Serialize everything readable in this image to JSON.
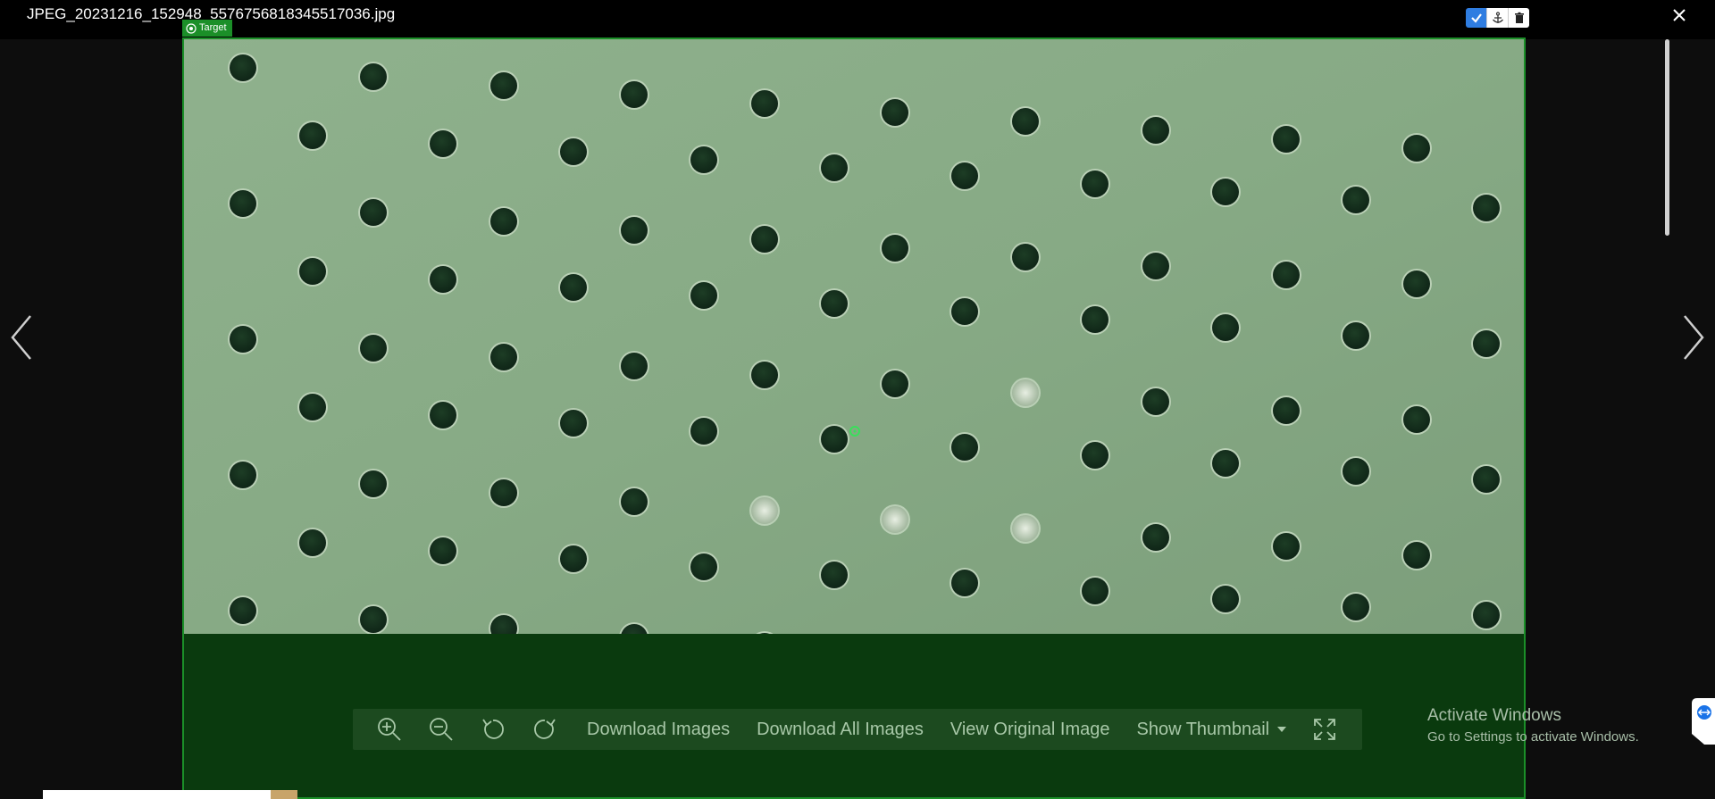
{
  "header": {
    "filename": "JPEG_20231216_152948_5576756818345517036.jpg"
  },
  "target": {
    "label": "Target"
  },
  "toolbar": {
    "download_images": "Download Images",
    "download_all_images": "Download All Images",
    "view_original_image": "View Original Image",
    "show_thumbnail": "Show Thumbnail"
  },
  "watermark": {
    "title": "Activate Windows",
    "subtitle": "Go to Settings to activate Windows."
  },
  "icons": {
    "confirm": "check-icon",
    "anchor": "anchor-icon",
    "delete": "trash-icon",
    "close": "close-icon",
    "prev": "chevron-left-icon",
    "next": "chevron-right-icon",
    "zoom_in": "zoom-in-icon",
    "zoom_out": "zoom-out-icon",
    "rotate_left": "rotate-left-icon",
    "rotate_right": "rotate-right-icon",
    "fullscreen": "fullscreen-icon"
  },
  "colors": {
    "target_green": "#1b8f28",
    "toolbar_bg": "#1c4a1f",
    "active_tool": "#2f7de1"
  }
}
